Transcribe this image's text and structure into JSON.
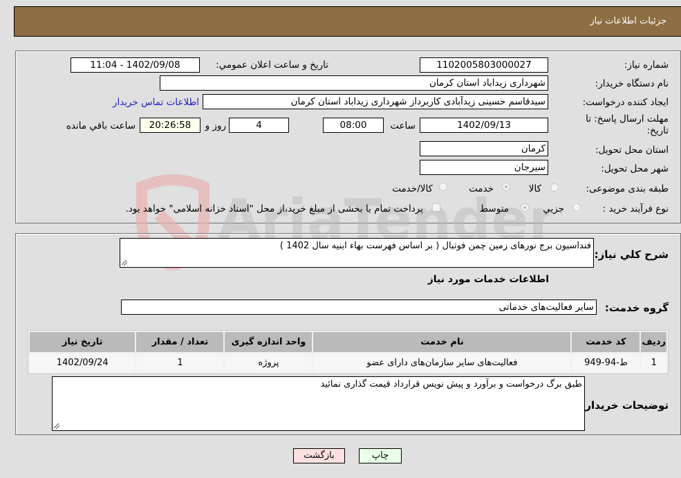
{
  "header": {
    "title": "جزئيات اطلاعات نياز"
  },
  "details": {
    "need_number": {
      "label": "شماره نیاز:",
      "value": "1102005803000027"
    },
    "announce_datetime": {
      "label": "تاريخ و ساعت اعلان عمومي:",
      "value": "1402/09/08 - 11:04"
    },
    "buyer_org": {
      "label": "نام دستگاه خریدار:",
      "value": "شهرداری زیداباد استان کرمان"
    },
    "requester": {
      "label": "ایجاد کننده درخواست:",
      "value": "سیدقاسم حسینی زیدآبادی کاربرداز شهرداری زیداباد استان کرمان"
    },
    "buyer_contact_link": "اطلاعات تماس خریدار",
    "deadline": {
      "label": "مهلت ارسال پاسخ: تا تاریخ:",
      "date": "1402/09/13",
      "time_label": "ساعت",
      "time": "08:00",
      "days": "4",
      "days_label": "روز و",
      "remaining": "20:26:58",
      "remaining_label": "ساعت باقي مانده"
    },
    "delivery_province": {
      "label": "استان محل تحویل:",
      "value": "کرمان"
    },
    "delivery_city": {
      "label": "شهر محل تحویل:",
      "value": "سیرجان"
    },
    "category": {
      "label": "طبقه بندی موضوعی:",
      "options": [
        "کالا",
        "خدمت",
        "کالا/خدمت"
      ],
      "selected": "خدمت"
    },
    "purchase_type": {
      "label": "نوع فرآیند خرید :",
      "options": [
        "جزيي",
        "متوسط"
      ],
      "selected": "متوسط",
      "treasury_checkbox_label": "پرداخت تمام یا بخشی از مبلغ خرید،از محل \"اسناد خزانه اسلامی\" خواهد بود.",
      "treasury_checked": false
    }
  },
  "description": {
    "label": "شرح كلي نياز:",
    "value": "فنداسیون برج نورهای زمین چمن فوتبال ( بر اساس فهرست بهاء ابنیه سال 1402 )"
  },
  "services_section": {
    "title": "اطلاعات خدمات مورد نياز",
    "service_group": {
      "label": "گروه خدمت:",
      "value": "سایر فعالیت‌های خدماتی"
    },
    "table": {
      "headers": [
        "رديف",
        "کد خدمت",
        "نام خدمت",
        "واحد اندازه گیری",
        "تعداد / مقدار",
        "تاریخ نیاز"
      ],
      "rows": [
        [
          "1",
          "ط-94-949",
          "فعالیت‌های سایر سازمان‌های دارای عضو",
          "پروژه",
          "1",
          "1402/09/24"
        ]
      ]
    }
  },
  "buyer_notes": {
    "label": "توضیحات خریدار:",
    "value": "طبق برگ درخواست و برآورد و پیش نویس قرارداد قیمت گذاری نمائید"
  },
  "buttons": {
    "print": "چاپ",
    "back": "بازگشت"
  },
  "watermark": {
    "text": "AriaTender.neT",
    "color_shield": "#e8a0a0",
    "color_text": "#b8b8b8"
  }
}
